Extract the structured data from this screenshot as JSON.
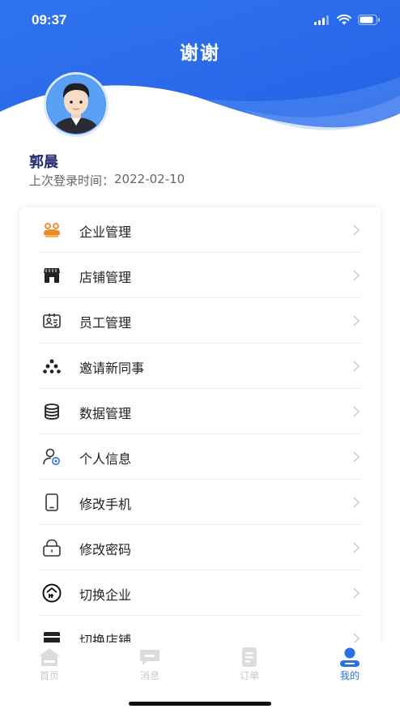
{
  "status_bar": {
    "time": "09:37"
  },
  "header": {
    "title": "谢谢",
    "accent_color": "#2b6fe8"
  },
  "user": {
    "name": "郭晨",
    "last_login_label": "上次登录时间：",
    "last_login_date": "2022-02-10"
  },
  "menu": {
    "items": [
      {
        "label": "企业管理",
        "icon": "enterprise-icon"
      },
      {
        "label": "店铺管理",
        "icon": "store-icon"
      },
      {
        "label": "员工管理",
        "icon": "staff-card-icon"
      },
      {
        "label": "邀请新同事",
        "icon": "org-tree-icon"
      },
      {
        "label": "数据管理",
        "icon": "database-icon"
      },
      {
        "label": "个人信息",
        "icon": "person-icon"
      },
      {
        "label": "修改手机",
        "icon": "phone-icon"
      },
      {
        "label": "修改密码",
        "icon": "lock-icon"
      },
      {
        "label": "切换企业",
        "icon": "switch-enterprise-icon"
      },
      {
        "label": "切换店铺",
        "icon": "switch-store-icon"
      }
    ]
  },
  "tab_bar": {
    "tabs": [
      {
        "label": "首页",
        "icon": "home-icon",
        "active": false
      },
      {
        "label": "消息",
        "icon": "message-icon",
        "active": false
      },
      {
        "label": "订单",
        "icon": "order-icon",
        "active": false
      },
      {
        "label": "我的",
        "icon": "profile-icon",
        "active": true
      }
    ]
  }
}
